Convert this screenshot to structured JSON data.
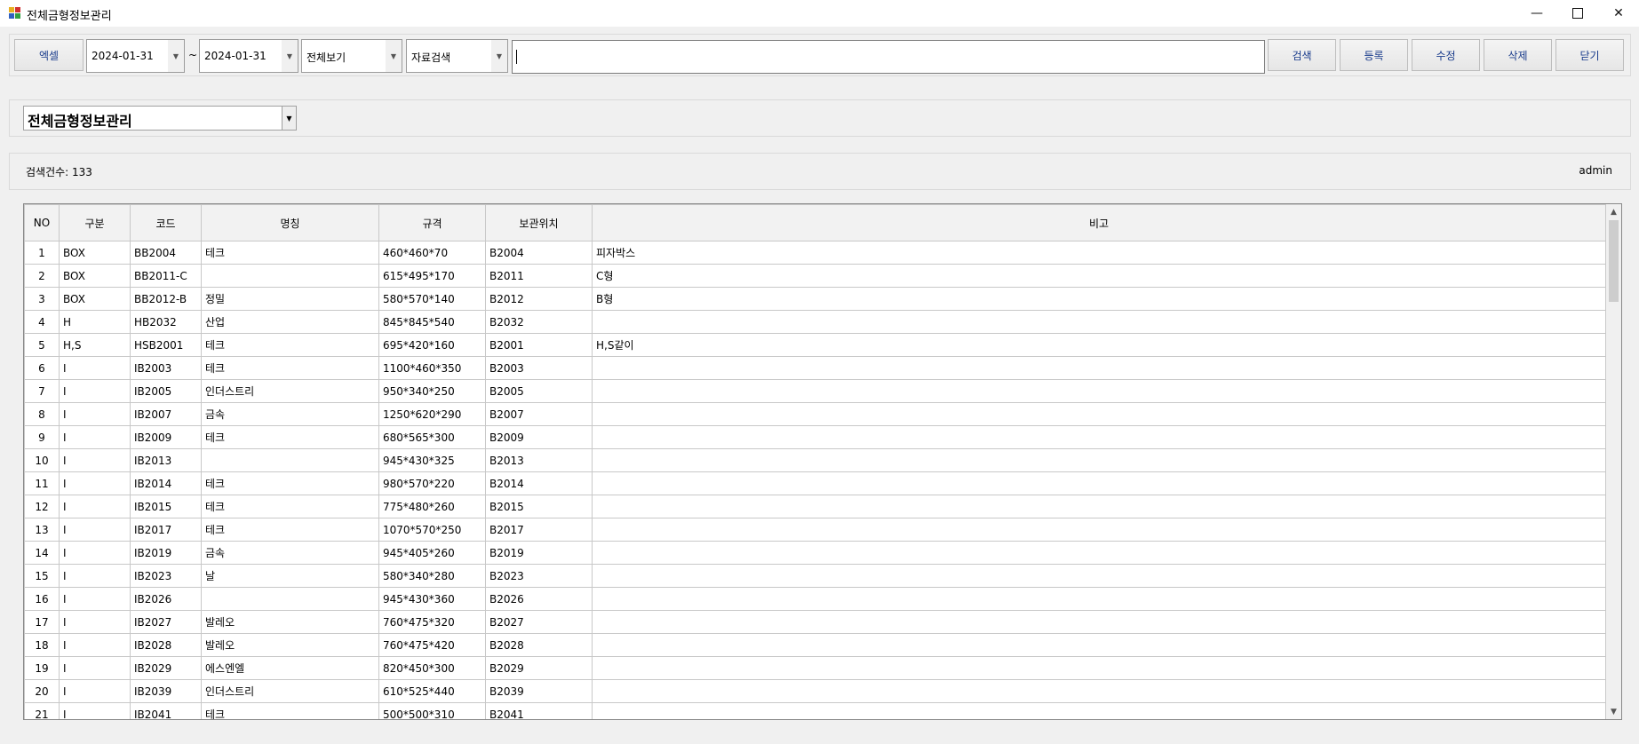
{
  "window": {
    "title": "전체금형정보관리",
    "minimize": "—",
    "close": "✕",
    "icon": "app-icon"
  },
  "toolbar": {
    "excel_label": "엑셀",
    "date_from": "2024-01-31",
    "date_to": "2024-01-31",
    "range_sep": "~",
    "view_select": "전체보기",
    "search_field_select": "자료검색",
    "search_value": "",
    "search_label": "검색",
    "register_label": "등록",
    "edit_label": "수정",
    "delete_label": "삭제",
    "close_label": "닫기"
  },
  "header": {
    "category_select": "전체금형정보관리"
  },
  "status": {
    "count_text": "검색건수: 133",
    "user": "admin"
  },
  "table": {
    "columns": [
      "NO",
      "구분",
      "코드",
      "명칭",
      "규격",
      "보관위치",
      "비고"
    ],
    "rows": [
      [
        "1",
        "BOX",
        "BB2004",
        "테크",
        "460*460*70",
        "B2004",
        "피자박스"
      ],
      [
        "2",
        "BOX",
        "BB2011-C",
        "",
        "615*495*170",
        "B2011",
        "C형"
      ],
      [
        "3",
        "BOX",
        "BB2012-B",
        "정밀",
        "580*570*140",
        "B2012",
        "B형"
      ],
      [
        "4",
        "H",
        "HB2032",
        "산업",
        "845*845*540",
        "B2032",
        ""
      ],
      [
        "5",
        "H,S",
        "HSB2001",
        "테크",
        "695*420*160",
        "B2001",
        "H,S같이"
      ],
      [
        "6",
        "I",
        "IB2003",
        "테크",
        "1100*460*350",
        "B2003",
        ""
      ],
      [
        "7",
        "I",
        "IB2005",
        "인더스트리",
        "950*340*250",
        "B2005",
        ""
      ],
      [
        "8",
        "I",
        "IB2007",
        "금속",
        "1250*620*290",
        "B2007",
        ""
      ],
      [
        "9",
        "I",
        "IB2009",
        "테크",
        "680*565*300",
        "B2009",
        ""
      ],
      [
        "10",
        "I",
        "IB2013",
        "",
        "945*430*325",
        "B2013",
        ""
      ],
      [
        "11",
        "I",
        "IB2014",
        "테크",
        "980*570*220",
        "B2014",
        ""
      ],
      [
        "12",
        "I",
        "IB2015",
        "테크",
        "775*480*260",
        "B2015",
        ""
      ],
      [
        "13",
        "I",
        "IB2017",
        "테크",
        "1070*570*250",
        "B2017",
        ""
      ],
      [
        "14",
        "I",
        "IB2019",
        "금속",
        "945*405*260",
        "B2019",
        ""
      ],
      [
        "15",
        "I",
        "IB2023",
        "날",
        "580*340*280",
        "B2023",
        ""
      ],
      [
        "16",
        "I",
        "IB2026",
        "",
        "945*430*360",
        "B2026",
        ""
      ],
      [
        "17",
        "I",
        "IB2027",
        "발레오",
        "760*475*320",
        "B2027",
        ""
      ],
      [
        "18",
        "I",
        "IB2028",
        "발레오",
        "760*475*420",
        "B2028",
        ""
      ],
      [
        "19",
        "I",
        "IB2029",
        "에스엔엘",
        "820*450*300",
        "B2029",
        ""
      ],
      [
        "20",
        "I",
        "IB2039",
        "인더스트리",
        "610*525*440",
        "B2039",
        ""
      ],
      [
        "21",
        "I",
        "IB2041",
        "테크",
        "500*500*310",
        "B2041",
        ""
      ]
    ]
  },
  "scrollbar": {
    "up_icon": "▲",
    "down_icon": "▼"
  }
}
